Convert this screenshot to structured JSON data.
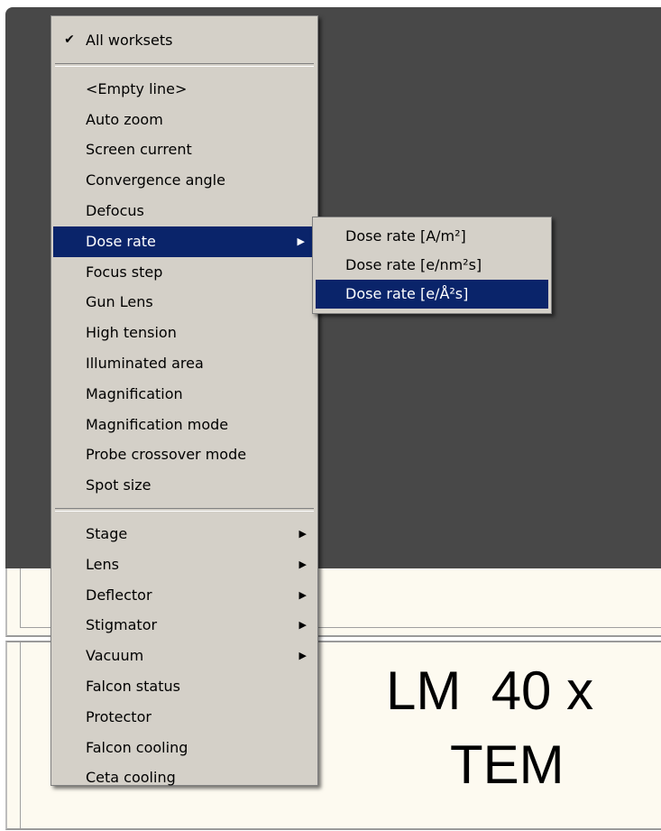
{
  "background": {
    "readout_line1": "LM  40 x",
    "readout_line2": "TEM"
  },
  "menu": {
    "top_item": {
      "label": "All  worksets",
      "checked": true,
      "check_glyph": "✔"
    },
    "group1": [
      "<Empty line>",
      "Auto zoom",
      "Screen current",
      "Convergence angle",
      "Defocus",
      "Dose rate",
      "Focus step",
      "Gun Lens",
      "High tension",
      "Illuminated area",
      "Magnification",
      "Magnification mode",
      "Probe crossover mode",
      "Spot size"
    ],
    "group2_submenus": [
      "Stage",
      "Lens",
      "Deflector",
      "Stigmator",
      "Vacuum"
    ],
    "group2_items": [
      "Falcon status",
      "Protector",
      "Falcon cooling",
      "Ceta cooling"
    ],
    "highlighted": "Dose rate",
    "submenu_arrow": "▶"
  },
  "submenu": {
    "items": [
      "Dose rate [A/m²]",
      "Dose rate [e/nm²s]",
      "Dose rate [e/Å²s]"
    ],
    "highlighted": "Dose rate [e/Å²s]"
  },
  "colors": {
    "highlight_bg": "#0a246a",
    "menu_bg": "#d4d0c8",
    "dark_panel": "#484848",
    "readout_bg": "#fdfaf0"
  }
}
